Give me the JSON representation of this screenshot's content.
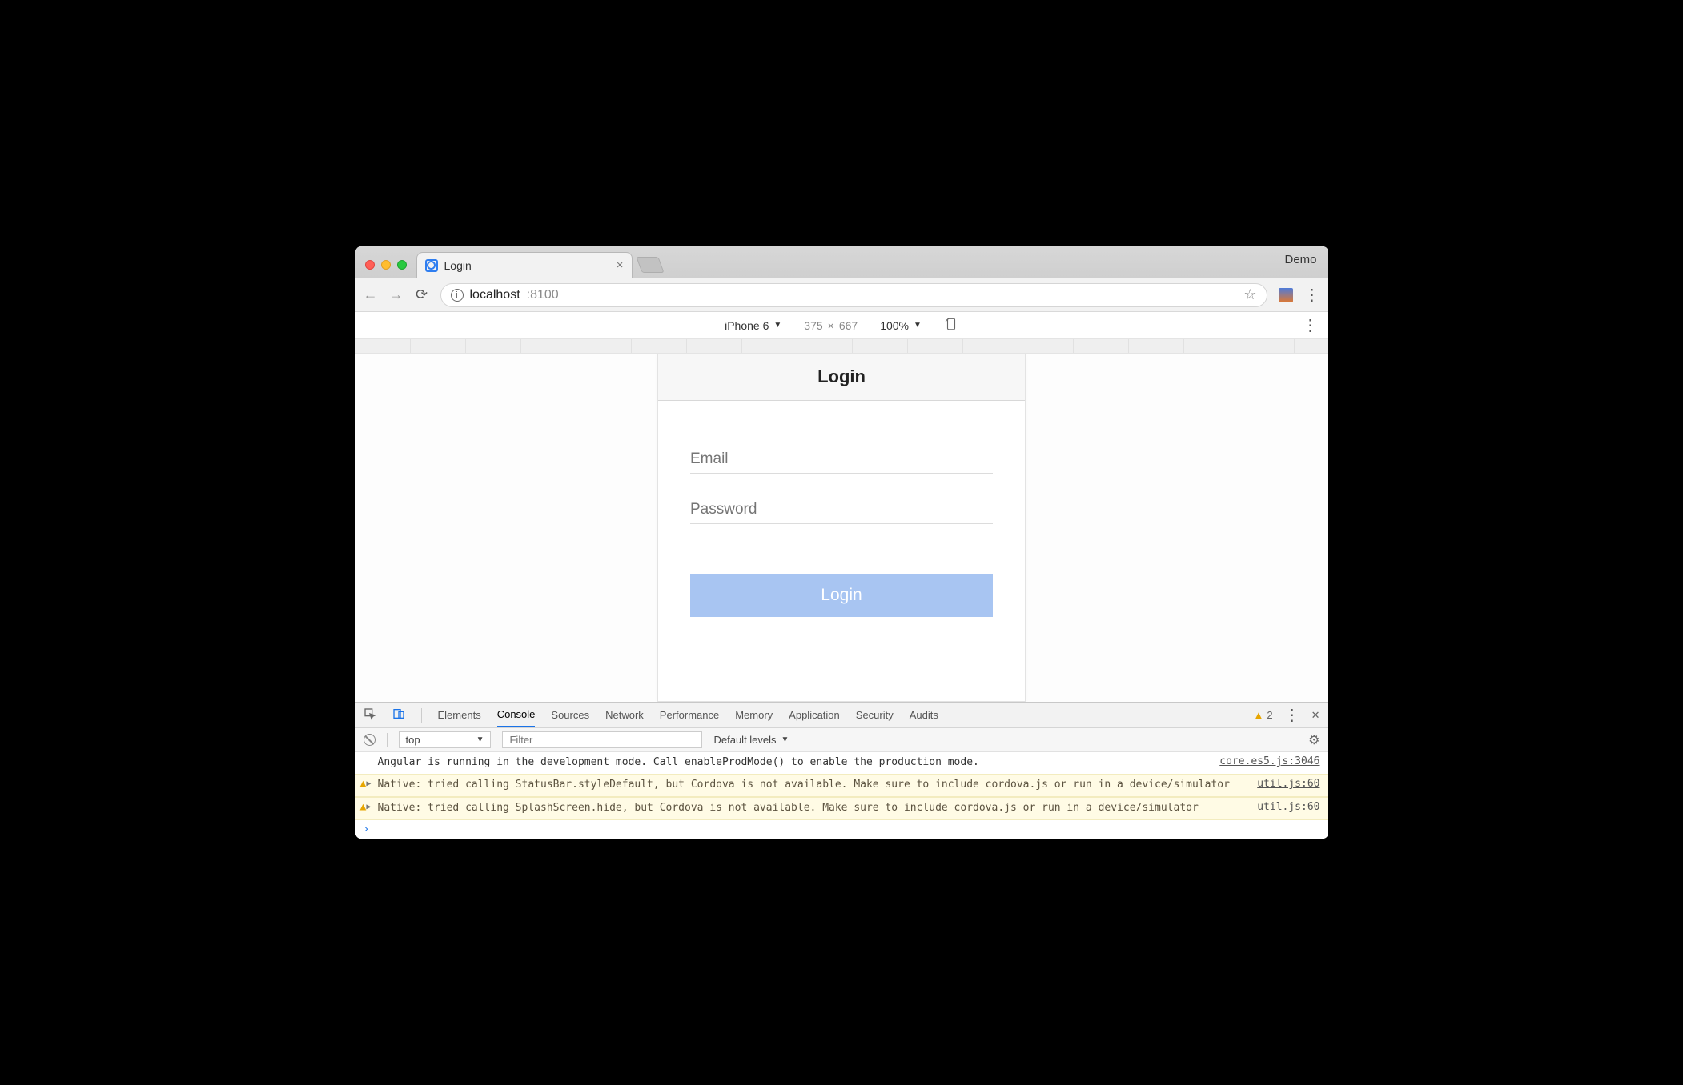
{
  "window": {
    "demo_label": "Demo"
  },
  "tab": {
    "title": "Login"
  },
  "address": {
    "host": "localhost",
    "port": ":8100"
  },
  "device_toolbar": {
    "device": "iPhone 6",
    "width": "375",
    "height": "667",
    "times": "×",
    "zoom": "100%"
  },
  "app": {
    "header": "Login",
    "email_placeholder": "Email",
    "password_placeholder": "Password",
    "login_button": "Login"
  },
  "devtools": {
    "tabs": {
      "elements": "Elements",
      "console": "Console",
      "sources": "Sources",
      "network": "Network",
      "performance": "Performance",
      "memory": "Memory",
      "application": "Application",
      "security": "Security",
      "audits": "Audits"
    },
    "warning_count": "2",
    "context": "top",
    "filter_placeholder": "Filter",
    "levels": "Default levels",
    "logs": [
      {
        "type": "log",
        "text": "Angular is running in the development mode. Call enableProdMode() to enable the production mode.",
        "source": "core.es5.js:3046"
      },
      {
        "type": "warn",
        "text": "Native: tried calling StatusBar.styleDefault, but Cordova is not available. Make sure to include cordova.js or run in a device/simulator",
        "source": "util.js:60"
      },
      {
        "type": "warn",
        "text": "Native: tried calling SplashScreen.hide, but Cordova is not available. Make sure to include cordova.js or run in a device/simulator",
        "source": "util.js:60"
      }
    ],
    "prompt": "›"
  }
}
